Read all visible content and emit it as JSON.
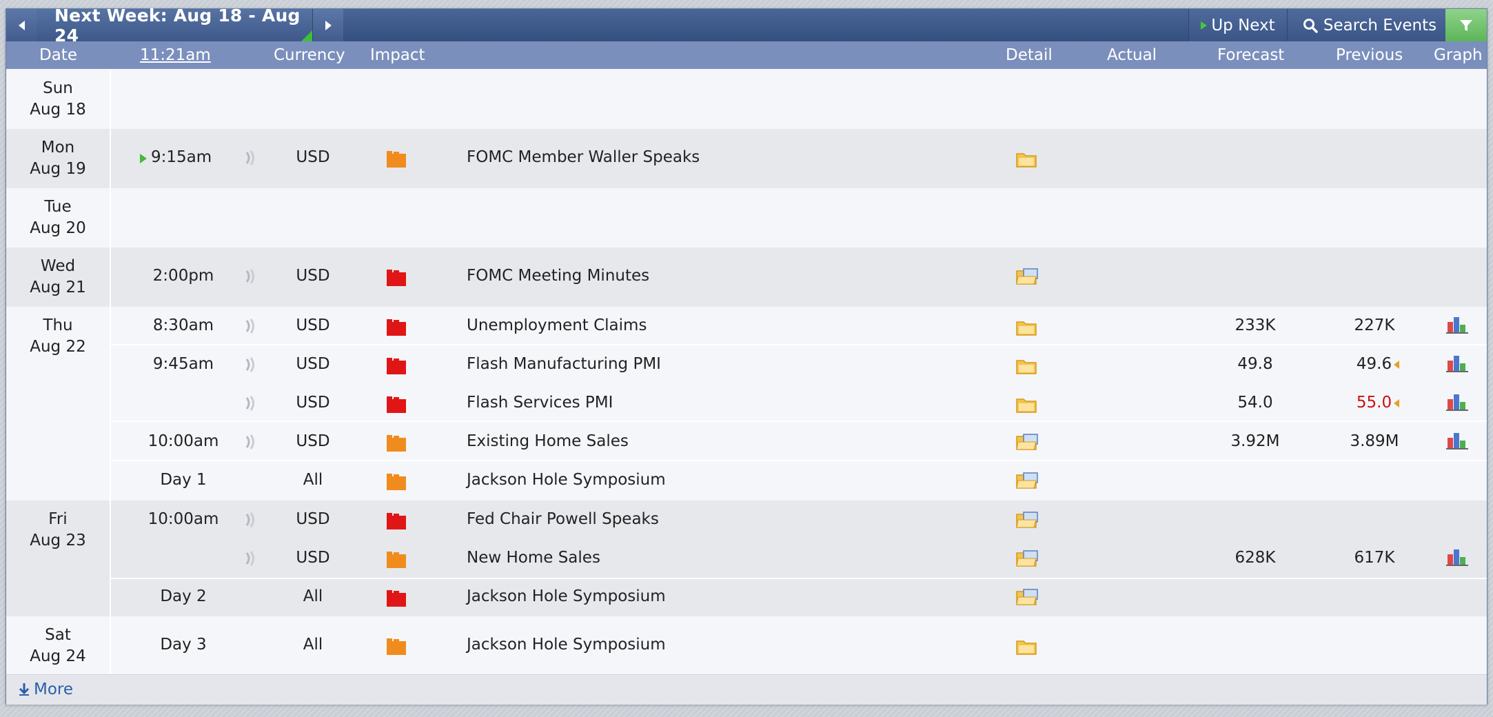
{
  "nav": {
    "week_title": "Next Week: Aug 18 - Aug 24",
    "up_next_label": "Up Next",
    "search_label": "Search Events"
  },
  "header": {
    "date": "Date",
    "time": "11:21am",
    "currency": "Currency",
    "impact": "Impact",
    "detail": "Detail",
    "actual": "Actual",
    "forecast": "Forecast",
    "previous": "Previous",
    "graph": "Graph"
  },
  "days": [
    {
      "dow": "Sun",
      "date": "Aug 18"
    },
    {
      "dow": "Mon",
      "date": "Aug 19"
    },
    {
      "dow": "Tue",
      "date": "Aug 20"
    },
    {
      "dow": "Wed",
      "date": "Aug 21"
    },
    {
      "dow": "Thu",
      "date": "Aug 22"
    },
    {
      "dow": "Fri",
      "date": "Aug 23"
    },
    {
      "dow": "Sat",
      "date": "Aug 24"
    }
  ],
  "events": [
    {
      "time": "9:15am",
      "currency": "USD",
      "impact": "medium",
      "name": "FOMC Member Waller Speaks",
      "forecast": "",
      "previous": ""
    },
    {
      "time": "2:00pm",
      "currency": "USD",
      "impact": "high",
      "name": "FOMC Meeting Minutes",
      "forecast": "",
      "previous": ""
    },
    {
      "time": "8:30am",
      "currency": "USD",
      "impact": "high",
      "name": "Unemployment Claims",
      "forecast": "233K",
      "previous": "227K"
    },
    {
      "time": "9:45am",
      "currency": "USD",
      "impact": "high",
      "name": "Flash Manufacturing PMI",
      "forecast": "49.8",
      "previous": "49.6"
    },
    {
      "time": "",
      "currency": "USD",
      "impact": "high",
      "name": "Flash Services PMI",
      "forecast": "54.0",
      "previous": "55.0"
    },
    {
      "time": "10:00am",
      "currency": "USD",
      "impact": "medium",
      "name": "Existing Home Sales",
      "forecast": "3.92M",
      "previous": "3.89M"
    },
    {
      "time": "Day 1",
      "currency": "All",
      "impact": "medium",
      "name": "Jackson Hole Symposium",
      "forecast": "",
      "previous": ""
    },
    {
      "time": "10:00am",
      "currency": "USD",
      "impact": "high",
      "name": "Fed Chair Powell Speaks",
      "forecast": "",
      "previous": ""
    },
    {
      "time": "",
      "currency": "USD",
      "impact": "medium",
      "name": "New Home Sales",
      "forecast": "628K",
      "previous": "617K"
    },
    {
      "time": "Day 2",
      "currency": "All",
      "impact": "high",
      "name": "Jackson Hole Symposium",
      "forecast": "",
      "previous": ""
    },
    {
      "time": "Day 3",
      "currency": "All",
      "impact": "medium",
      "name": "Jackson Hole Symposium",
      "forecast": "",
      "previous": ""
    }
  ],
  "colors": {
    "high_impact": "#e01616",
    "medium_impact": "#f08c1e",
    "revised_previous": "#cc1010",
    "header_bar": "#7b8fbd",
    "top_bar": "#3d5889"
  },
  "icons": {
    "sound": "speaker-wave-icon",
    "detail": "folder-icon",
    "graph": "bar-chart-icon",
    "filter": "filter-icon",
    "search": "magnifier-icon",
    "more": "download-arrow-icon"
  },
  "footer": {
    "more_label": "More"
  }
}
